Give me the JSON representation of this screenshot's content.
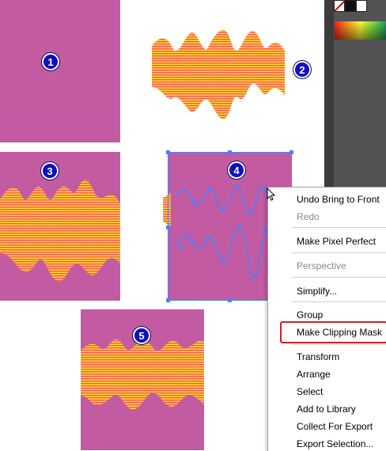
{
  "badges": {
    "b1": "1",
    "b2": "2",
    "b3": "3",
    "b4": "4",
    "b5": "5"
  },
  "context_menu": {
    "items": [
      {
        "label": "Undo Bring to Front",
        "enabled": true
      },
      {
        "label": "Redo",
        "enabled": false
      },
      {
        "label": "Make Pixel Perfect",
        "enabled": true
      },
      {
        "label": "Perspective",
        "enabled": false
      },
      {
        "label": "Simplify...",
        "enabled": true
      },
      {
        "label": "Group",
        "enabled": true
      },
      {
        "label": "Make Clipping Mask",
        "enabled": true,
        "highlighted": true
      },
      {
        "label": "Transform",
        "enabled": true
      },
      {
        "label": "Arrange",
        "enabled": true
      },
      {
        "label": "Select",
        "enabled": true
      },
      {
        "label": "Add to Library",
        "enabled": true
      },
      {
        "label": "Collect For Export",
        "enabled": true
      },
      {
        "label": "Export Selection...",
        "enabled": true
      }
    ]
  },
  "colors": {
    "artboard": "#c25ba2",
    "badge": "#1010c0",
    "selection": "#4d7fff",
    "highlight": "#d42020"
  }
}
